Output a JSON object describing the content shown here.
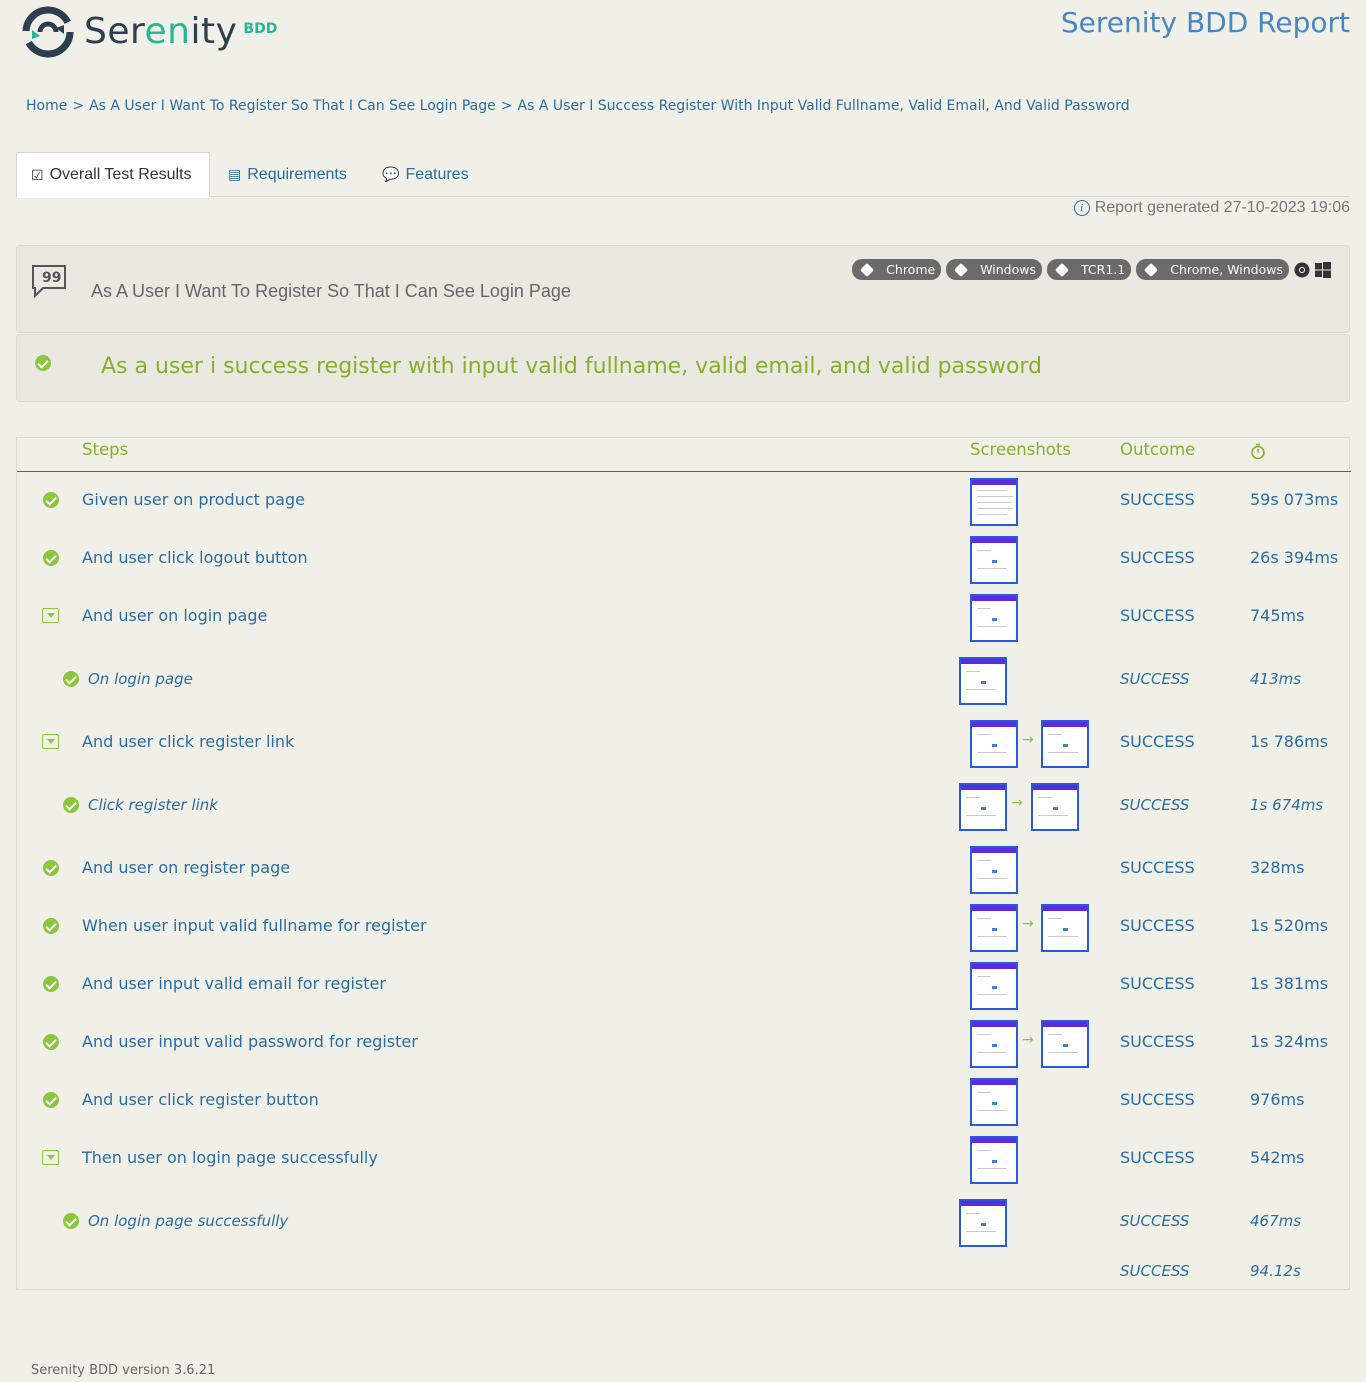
{
  "brand": {
    "name_left": "Ser",
    "name_accent": "en",
    "name_right": "ity",
    "suffix": "BDD",
    "logo_icon": "serenity-logo-icon"
  },
  "header": {
    "report_title": "Serenity BDD Report"
  },
  "breadcrumb": [
    "Home",
    "As A User I Want To Register So That I Can See Login Page",
    "As A User I Success Register With Input Valid Fullname, Valid Email, And Valid Password"
  ],
  "breadcrumb_separator": ">",
  "tabs": [
    {
      "label": "Overall Test Results",
      "icon": "checklist-icon",
      "active": true
    },
    {
      "label": "Requirements",
      "icon": "document-icon",
      "active": false
    },
    {
      "label": "Features",
      "icon": "comment-icon",
      "active": false
    }
  ],
  "report_generated": "Report generated 27-10-2023 19:06",
  "requirement": {
    "title": "As A User I Want To Register So That I Can See Login Page",
    "tags": [
      "Chrome",
      "Windows",
      "TCR1.1",
      "Chrome, Windows"
    ]
  },
  "scenario": {
    "title": "As a user i success register with input valid fullname, valid email, and valid password",
    "status_color": "#8aad2a"
  },
  "table": {
    "headers": {
      "steps": "Steps",
      "screenshots": "Screenshots",
      "outcome": "Outcome",
      "duration_icon": "stopwatch-icon"
    },
    "rows": [
      {
        "desc": "Given user on product page",
        "outcome": "SUCCESS",
        "duration": "59s 073ms"
      },
      {
        "desc": "And user click logout button",
        "outcome": "SUCCESS",
        "duration": "26s 394ms"
      },
      {
        "desc": "And user on login page",
        "outcome": "SUCCESS",
        "duration": "745ms"
      },
      {
        "desc": "On login page",
        "outcome": "SUCCESS",
        "duration": "413ms"
      },
      {
        "desc": "And user click register link",
        "outcome": "SUCCESS",
        "duration": "1s 786ms"
      },
      {
        "desc": "Click register link",
        "outcome": "SUCCESS",
        "duration": "1s 674ms"
      },
      {
        "desc": "And user on register page",
        "outcome": "SUCCESS",
        "duration": "328ms"
      },
      {
        "desc": "When user input valid fullname for register",
        "outcome": "SUCCESS",
        "duration": "1s 520ms"
      },
      {
        "desc": "And user input valid email for register",
        "outcome": "SUCCESS",
        "duration": "1s 381ms"
      },
      {
        "desc": "And user input valid password for register",
        "outcome": "SUCCESS",
        "duration": "1s 324ms"
      },
      {
        "desc": "And user click register button",
        "outcome": "SUCCESS",
        "duration": "976ms"
      },
      {
        "desc": "Then user on login page successfully",
        "outcome": "SUCCESS",
        "duration": "542ms"
      },
      {
        "desc": "On login page successfully",
        "outcome": "SUCCESS",
        "duration": "467ms"
      }
    ],
    "total": {
      "outcome": "SUCCESS",
      "duration": "94.12s"
    }
  },
  "footer": {
    "version": "Serenity BDD version 3.6.21"
  },
  "colors": {
    "link": "#2b6ca3",
    "success_green": "#8cc63f",
    "title_blue": "#4a86c5",
    "screenshot_border": "#2a5bd7"
  }
}
